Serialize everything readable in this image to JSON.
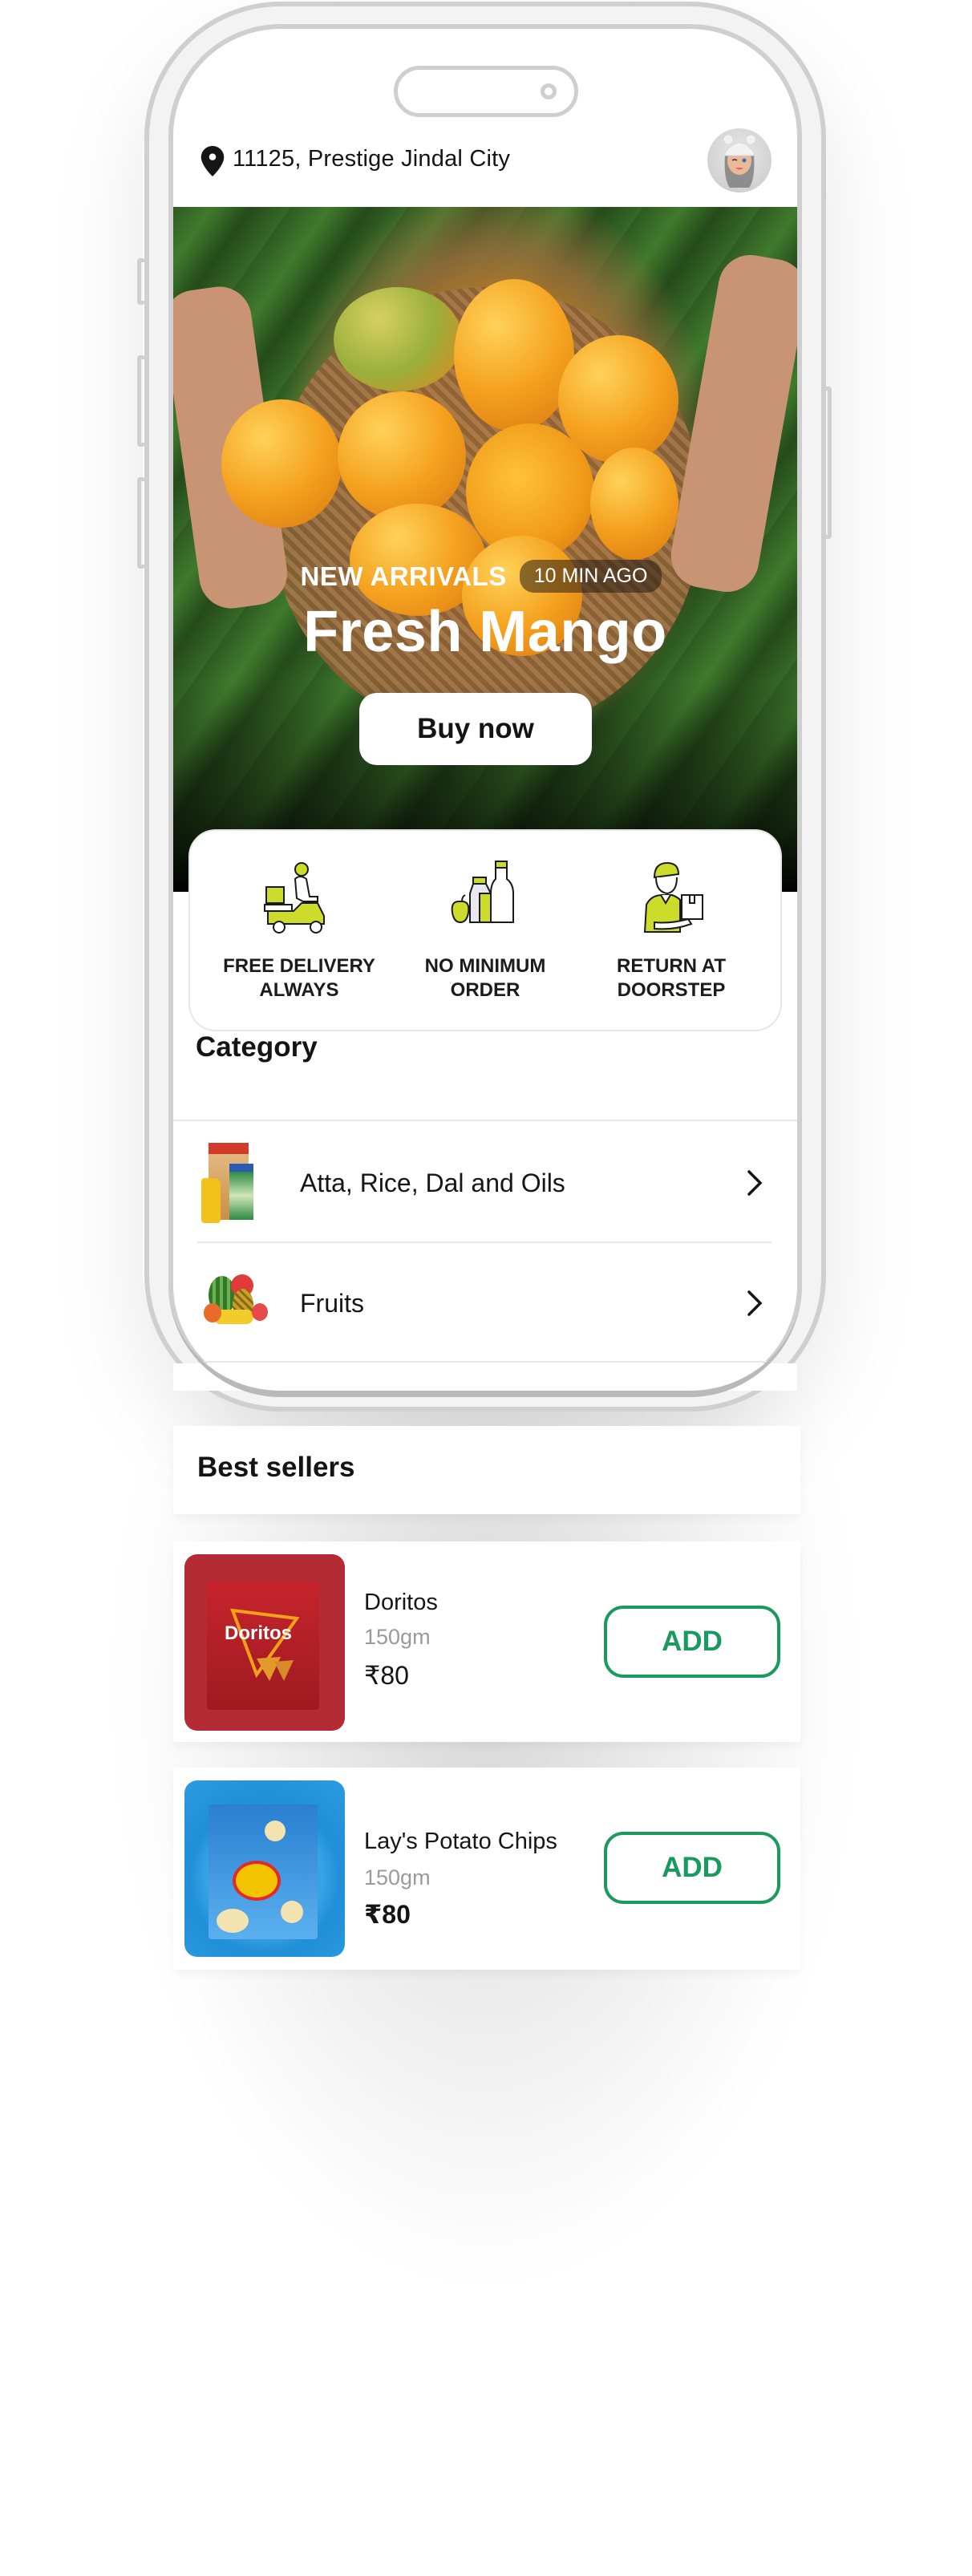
{
  "header": {
    "location_icon": "map-pin-icon",
    "location": "11125, Prestige Jindal City",
    "avatar_icon": "user-avatar"
  },
  "hero": {
    "tagline": "NEW ARRIVALS",
    "time_badge": "10 MIN AGO",
    "title": "Fresh Mango",
    "cta": "Buy now"
  },
  "features": [
    {
      "icon": "scooter-delivery-icon",
      "label": "FREE DELIVERY ALWAYS"
    },
    {
      "icon": "groceries-icon",
      "label": "NO MINIMUM ORDER"
    },
    {
      "icon": "delivery-person-icon",
      "label": "RETURN AT DOORSTEP"
    }
  ],
  "category": {
    "title": "Category",
    "items": [
      {
        "label": "Atta, Rice, Dal and Oils",
        "icon": "chevron-right-icon"
      },
      {
        "label": "Fruits",
        "icon": "chevron-right-icon"
      }
    ]
  },
  "best_sellers": {
    "title": "Best sellers",
    "products": [
      {
        "name": "Doritos",
        "quantity": "150gm",
        "price": "₹80",
        "add_label": "ADD"
      },
      {
        "name": "Lay's Potato Chips",
        "quantity": "150gm",
        "price": "₹80",
        "add_label": "ADD"
      }
    ]
  },
  "colors": {
    "accent_green": "#1a9a5e",
    "icon_lime": "#cddc2b",
    "doritos_red": "#b42b35",
    "lays_blue": "#1f8fd8"
  }
}
